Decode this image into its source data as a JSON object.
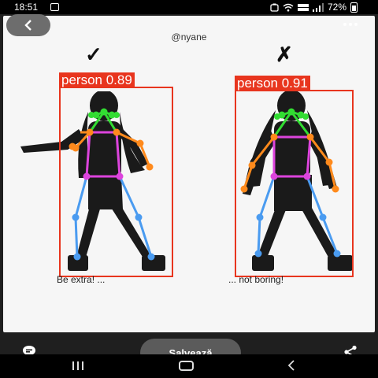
{
  "status_bar": {
    "time": "18:51",
    "battery": "72%"
  },
  "post": {
    "username": "@nyane",
    "left": {
      "mark": "✓",
      "detection_label": "person 0.89",
      "caption": "Be extra! ..."
    },
    "right": {
      "mark": "✗",
      "detection_label": "person 0.91",
      "caption": "... not boring!"
    }
  },
  "bottom_bar": {
    "save_label": "Salvează"
  },
  "colors": {
    "detection_box": "#e8351e",
    "keypoint_head": "#32dc32",
    "keypoint_arms": "#ff8a1c",
    "keypoint_torso": "#dd44dd",
    "keypoint_legs": "#4a9bf0"
  }
}
